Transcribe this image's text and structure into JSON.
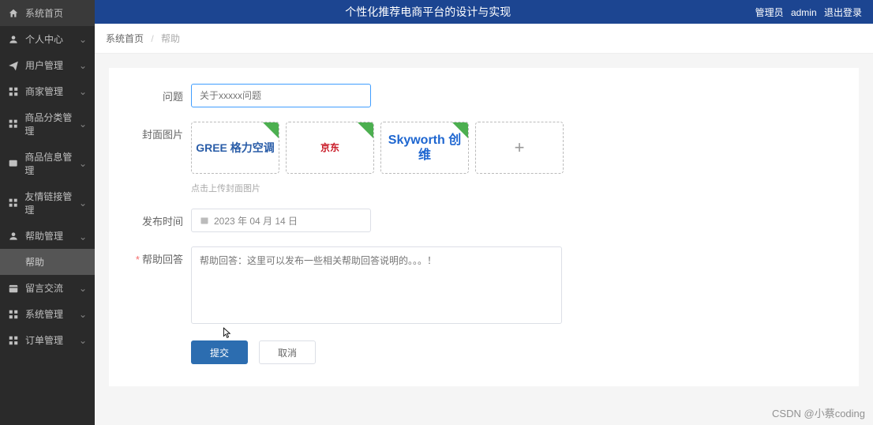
{
  "header": {
    "title": "个性化推荐电商平台的设计与实现",
    "admin_label": "管理员",
    "admin_name": "admin",
    "logout": "退出登录"
  },
  "breadcrumb": {
    "home": "系统首页",
    "current": "帮助"
  },
  "sidebar": {
    "items": [
      {
        "label": "系统首页",
        "icon": "home",
        "expandable": false
      },
      {
        "label": "个人中心",
        "icon": "user",
        "expandable": true
      },
      {
        "label": "用户管理",
        "icon": "send",
        "expandable": true
      },
      {
        "label": "商家管理",
        "icon": "grid",
        "expandable": true
      },
      {
        "label": "商品分类管理",
        "icon": "grid",
        "expandable": true
      },
      {
        "label": "商品信息管理",
        "icon": "card",
        "expandable": true
      },
      {
        "label": "友情链接管理",
        "icon": "grid",
        "expandable": true
      },
      {
        "label": "帮助管理",
        "icon": "user",
        "expandable": true,
        "expanded": true
      },
      {
        "label": "留言交流",
        "icon": "calendar",
        "expandable": true
      },
      {
        "label": "系统管理",
        "icon": "grid",
        "expandable": true
      },
      {
        "label": "订单管理",
        "icon": "grid",
        "expandable": true
      }
    ],
    "sub_item": "帮助"
  },
  "form": {
    "question_label": "问题",
    "question_placeholder": "关于xxxxx问题",
    "cover_label": "封面图片",
    "cover_hint": "点击上传封面图片",
    "images": [
      {
        "display": "GREE 格力空调",
        "color": "#2a5da8"
      },
      {
        "display": "京东",
        "color": "#c81623"
      },
      {
        "display": "Skyworth 创维",
        "color": "#1e66d0"
      }
    ],
    "date_label": "发布时间",
    "date_value": "2023 年 04 月 14 日",
    "answer_label": "帮助回答",
    "answer_placeholder": "帮助回答：这里可以发布一些相关帮助回答说明的。。。！",
    "submit": "提交",
    "cancel": "取消"
  },
  "watermark": "CSDN @小蔡coding"
}
